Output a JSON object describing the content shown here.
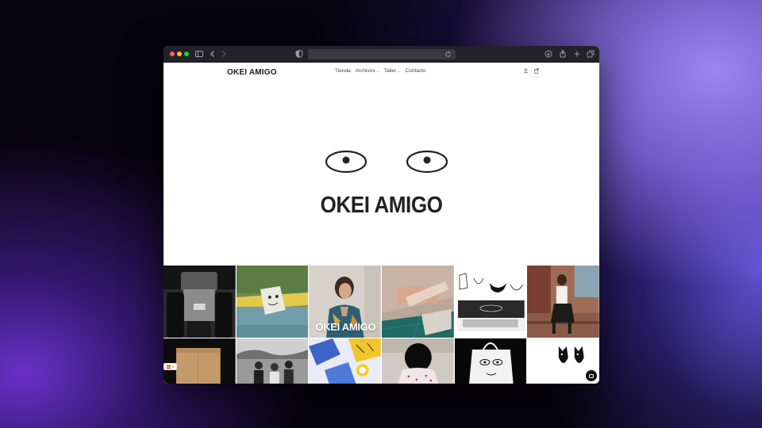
{
  "site": {
    "logo_text": "OKEI AMIGO",
    "hero_brand": "OKEI AMIGO"
  },
  "nav": {
    "items": [
      {
        "label": "Tienda",
        "has_dropdown": false
      },
      {
        "label": "Archivos",
        "has_dropdown": true
      },
      {
        "label": "Taller",
        "has_dropdown": true
      },
      {
        "label": "Contacto",
        "has_dropdown": false
      }
    ],
    "account_icon": "user-icon",
    "cart_icon": "bag-icon"
  },
  "carousel": {
    "slides": 2,
    "active": 1
  },
  "gallery": {
    "featured_caption": "OKEI AMIGO"
  },
  "colors": {
    "brand_text": "#222226",
    "traffic_red": "#ff5f57",
    "traffic_yellow": "#febc2e",
    "traffic_green": "#28c840"
  }
}
